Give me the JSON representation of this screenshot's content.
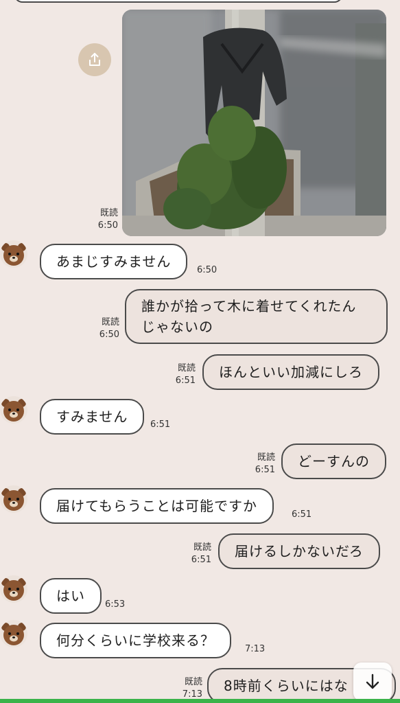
{
  "thumb_caption": "Jacket hung on a street tree",
  "messages": [
    {
      "side": "out",
      "type": "image",
      "read": "既読",
      "time": "6:50"
    },
    {
      "side": "in",
      "text": "あまじすみません",
      "time": "6:50"
    },
    {
      "side": "out",
      "line1": "誰かが拾って木に着せてくれたん",
      "line2": "じゃないの",
      "read": "既読",
      "time": "6:50"
    },
    {
      "side": "out",
      "text": "ほんといい加減にしろ",
      "read": "既読",
      "time": "6:51"
    },
    {
      "side": "in",
      "text": "すみません",
      "time": "6:51"
    },
    {
      "side": "out",
      "text": "どーすんの",
      "read": "既読",
      "time": "6:51"
    },
    {
      "side": "in",
      "text": "届けてもらうことは可能ですか",
      "time": "6:51"
    },
    {
      "side": "out",
      "text": "届けるしかないだろ",
      "read": "既読",
      "time": "6:51"
    },
    {
      "side": "in",
      "text": "はい",
      "time": "6:53"
    },
    {
      "side": "in",
      "text": "何分くらいに学校来る？",
      "time": "7:13"
    },
    {
      "side": "out",
      "text": "8時前くらいにはな",
      "read": "既読",
      "time": "7:13"
    }
  ],
  "icons": {
    "share": "share-icon",
    "avatar": "bear-avatar-icon",
    "scroll": "arrow-down-icon"
  },
  "colors": {
    "background": "#f1e8e4",
    "bubble_in": "#ffffff",
    "bubble_out": "#ede3de",
    "share_button": "#d8c6b0",
    "bottom_bar": "#3bb34a"
  }
}
